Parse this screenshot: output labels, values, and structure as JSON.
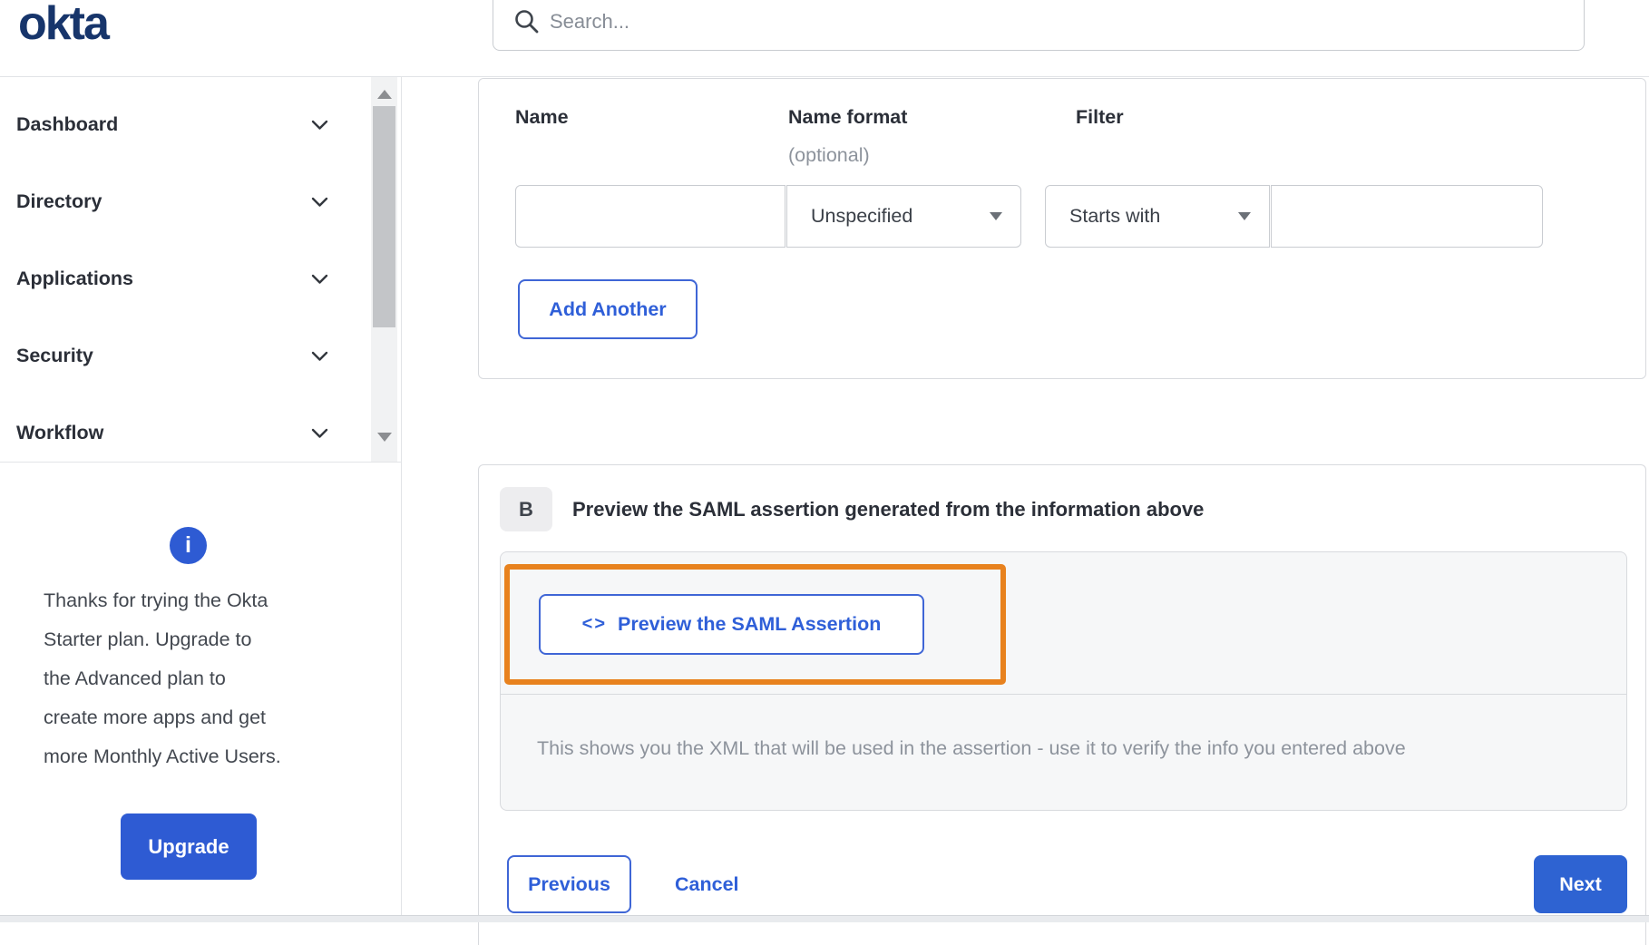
{
  "brand": {
    "logo_text": "okta"
  },
  "search": {
    "placeholder": "Search..."
  },
  "sidebar": {
    "nav_items": [
      {
        "label": "Dashboard"
      },
      {
        "label": "Directory"
      },
      {
        "label": "Applications"
      },
      {
        "label": "Security"
      },
      {
        "label": "Workflow"
      }
    ],
    "promo": {
      "info_glyph": "i",
      "lines": [
        "Thanks for trying the Okta",
        "Starter plan. Upgrade to",
        "the Advanced plan to",
        "create more apps and get",
        "more Monthly Active Users."
      ],
      "upgrade_label": "Upgrade"
    }
  },
  "attribute_form": {
    "columns": [
      {
        "label": "Name",
        "sublabel": ""
      },
      {
        "label": "Name format",
        "sublabel": "(optional)"
      },
      {
        "label": "Filter",
        "sublabel": ""
      }
    ],
    "name_value": "",
    "name_format_selected": "Unspecified",
    "filter_type_selected": "Starts with",
    "filter_value": "",
    "add_another_label": "Add Another"
  },
  "section_b": {
    "badge": "B",
    "title": "Preview the SAML assertion generated from the information above",
    "preview_icon_glyph": "<>",
    "preview_button_label": "Preview the SAML Assertion",
    "description": "This shows you the XML that will be used in the assertion - use it to verify the info you entered above"
  },
  "footer": {
    "previous_label": "Previous",
    "cancel_label": "Cancel",
    "next_label": "Next"
  },
  "icons": {
    "search": "magnifier",
    "nav_expand": "chevron-down",
    "select_caret": "caret-down",
    "info": "info-circle",
    "scrollbar": "arrow-up / arrow-down"
  },
  "colors": {
    "primary_blue": "#2e5bd3",
    "link_blue": "#2f5fd8",
    "logo_navy": "#17356b",
    "highlight_orange": "#e8821e",
    "panel_gray": "#f6f7f8"
  }
}
